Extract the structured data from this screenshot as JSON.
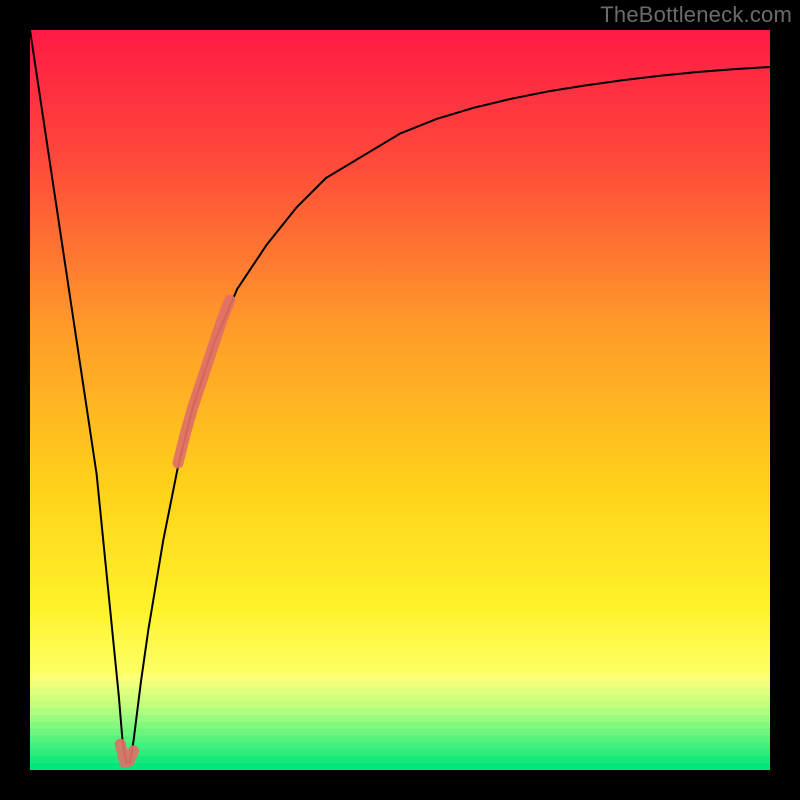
{
  "watermark": "TheBottleneck.com",
  "chart_data": {
    "type": "line",
    "title": "",
    "xlabel": "",
    "ylabel": "",
    "xlim": [
      0,
      100
    ],
    "ylim": [
      0,
      100
    ],
    "grid": false,
    "background": {
      "kind": "vertical-gradient",
      "top_color": "#ff1a46",
      "mid_color": "#fff000",
      "bottom_zone_start": 0.87,
      "bottom_zone_colors": [
        "#ffff7a",
        "#b8ff80",
        "#00e67a"
      ]
    },
    "curve_comment": "Black curve: bottleneck percentage-like metric that drops sharply to ~0 at x≈13 then rises asymptotically toward ~95.",
    "x": [
      0,
      3,
      6,
      9,
      11,
      12,
      12.5,
      13,
      13.5,
      14,
      15,
      16,
      18,
      20,
      22,
      25,
      28,
      32,
      36,
      40,
      45,
      50,
      55,
      60,
      65,
      70,
      75,
      80,
      85,
      90,
      95,
      100
    ],
    "y": [
      100,
      80,
      60,
      40,
      20,
      10,
      4,
      1,
      1,
      4,
      12,
      19,
      31,
      41,
      49,
      58,
      65,
      71,
      76,
      80,
      83,
      86,
      88,
      89.5,
      90.7,
      91.7,
      92.5,
      93.2,
      93.8,
      94.3,
      94.7,
      95
    ],
    "series": [
      {
        "name": "bottleneck-curve",
        "color": "#000000",
        "stroke_width": 2,
        "uses_xy": true
      }
    ],
    "markers": {
      "comment": "Coral stroke segments overlaid on the curve near the trough and on the rising limb.",
      "color": "#e17066",
      "stroke_width": 11,
      "segments": [
        {
          "x": [
            12.2,
            12.8,
            13.4,
            14.0
          ],
          "y": [
            3.5,
            1.0,
            1.2,
            2.6
          ]
        },
        {
          "x": [
            20,
            21,
            22,
            23,
            24,
            25,
            26,
            27
          ],
          "y": [
            41.5,
            45.5,
            49,
            52,
            55,
            58,
            61,
            63.5
          ]
        }
      ]
    }
  }
}
